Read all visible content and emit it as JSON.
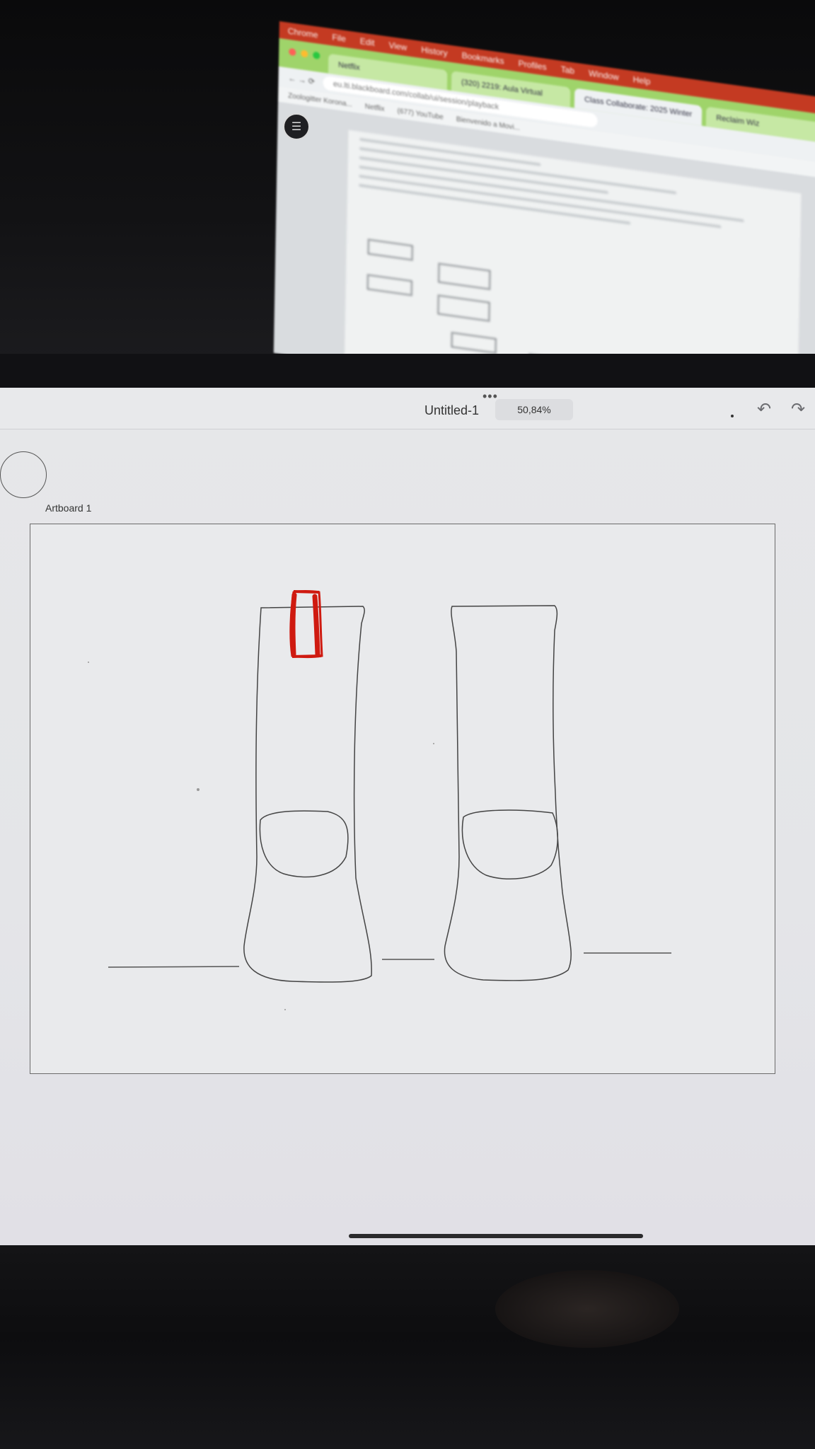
{
  "laptop": {
    "menu_items": [
      "Chrome",
      "File",
      "Edit",
      "View",
      "History",
      "Bookmarks",
      "Profiles",
      "Tab",
      "Window",
      "Help"
    ],
    "tabs": [
      "Netflix",
      "(320) 2219: Aula Virtual",
      "Class Collaborate: 2025 Winter",
      "Reclaim Wiz"
    ],
    "url": "eu.lti.blackboard.com/collab/ui/session/playback",
    "bookmarks": [
      "Zoologitter Korona...",
      "Netflix",
      "(677) YouTube",
      "Bienvenido a Movi..."
    ]
  },
  "app": {
    "title": "Untitled-1",
    "zoom": "50,84%",
    "more_icon": "•••",
    "undo_icon": "↶",
    "redo_icon": "↷",
    "artboard_label": "Artboard 1"
  }
}
